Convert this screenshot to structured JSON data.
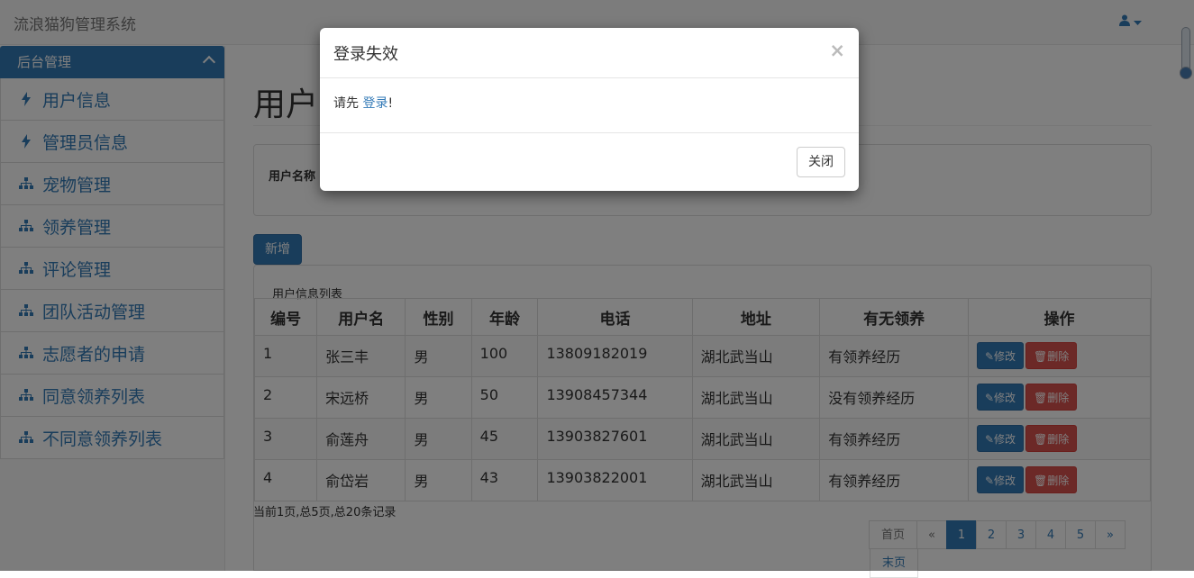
{
  "app": {
    "title": "流浪猫狗管理系统",
    "user_icon": "user-icon"
  },
  "sidebar": {
    "header": "后台管理",
    "items": [
      {
        "label": "用户信息",
        "icon": "bolt-icon"
      },
      {
        "label": "管理员信息",
        "icon": "bolt-icon"
      },
      {
        "label": "宠物管理",
        "icon": "sitemap-icon"
      },
      {
        "label": "领养管理",
        "icon": "sitemap-icon"
      },
      {
        "label": "评论管理",
        "icon": "sitemap-icon"
      },
      {
        "label": "团队活动管理",
        "icon": "sitemap-icon"
      },
      {
        "label": "志愿者的申请",
        "icon": "sitemap-icon"
      },
      {
        "label": "同意领养列表",
        "icon": "sitemap-icon"
      },
      {
        "label": "不同意领养列表",
        "icon": "sitemap-icon"
      }
    ]
  },
  "main": {
    "page_title": "用户",
    "search_label": "用户名称",
    "add_button": "新增",
    "table_caption": "用户信息列表",
    "columns": [
      "编号",
      "用户名",
      "性别",
      "年龄",
      "电话",
      "地址",
      "有无领养",
      "操作"
    ],
    "rows": [
      [
        "1",
        "张三丰",
        "男",
        "100",
        "13809182019",
        "湖北武当山",
        "有领养经历"
      ],
      [
        "2",
        "宋远桥",
        "男",
        "50",
        "13908457344",
        "湖北武当山",
        "没有领养经历"
      ],
      [
        "3",
        "俞莲舟",
        "男",
        "45",
        "13903827601",
        "湖北武当山",
        "有领养经历"
      ],
      [
        "4",
        "俞岱岩",
        "男",
        "43",
        "13903822001",
        "湖北武当山",
        "有领养经历"
      ]
    ],
    "edit_label": "修改",
    "delete_label": "删除",
    "pager_info": "当前1页,总5页,总20条记录",
    "pagination": {
      "first": "首页",
      "prev": "«",
      "pages": [
        "1",
        "2",
        "3",
        "4",
        "5"
      ],
      "next": "»",
      "last": "末页",
      "current": "1"
    }
  },
  "modal": {
    "title": "登录失效",
    "close_symbol": "×",
    "message_prefix": "请先",
    "message_link": "登录",
    "message_suffix": "!",
    "close_button": "关闭"
  },
  "colors": {
    "primary": "#337ab7",
    "danger": "#d9534f"
  }
}
